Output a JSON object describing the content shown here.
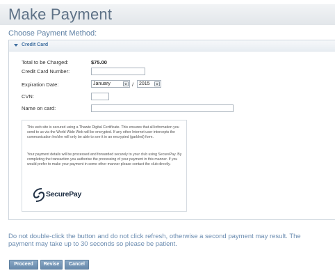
{
  "page": {
    "title": "Make Payment",
    "section_heading": "Choose Payment Method:"
  },
  "panel": {
    "title": "Credit Card"
  },
  "form": {
    "total_label": "Total to be Charged:",
    "total_value": "$75.00",
    "card_number_label": "Credit Card Number:",
    "card_number_value": "",
    "expiration_label": "Expiration Date:",
    "expiration_month": "January",
    "expiration_separator": "/",
    "expiration_year": "2015",
    "cvn_label": "CVN:",
    "cvn_value": "",
    "name_label": "Name on card:",
    "name_value": ""
  },
  "info": {
    "paragraph1": "This web site is secured using a Thawte Digital Certificate. This ensures that all information you send to us via the World Wide Web will be encrypted. If any other Internet user intercepts the communication he/she will only be able to see it in an encrypted (garbled) form.",
    "paragraph2": "Your payment details will be processed and forwarded securely to your club using SecurePay. By completing the transaction you authorise the processing of your payment in this manner. If you would prefer to make your payment in some other manner please contact the club directly.",
    "logo_text": "SecurePay"
  },
  "notice": {
    "line1": "Do not double-click the button and do not click refresh, otherwise a second payment may result. The",
    "line2": "payment may take up to 30 seconds so please be patient."
  },
  "buttons": {
    "proceed": "Proceed",
    "revise": "Revise",
    "cancel": "Cancel"
  },
  "colors": {
    "title": "#5d7186",
    "accent": "#3f6fa0",
    "notice": "#6b8cb0",
    "button": "#7294b6"
  }
}
